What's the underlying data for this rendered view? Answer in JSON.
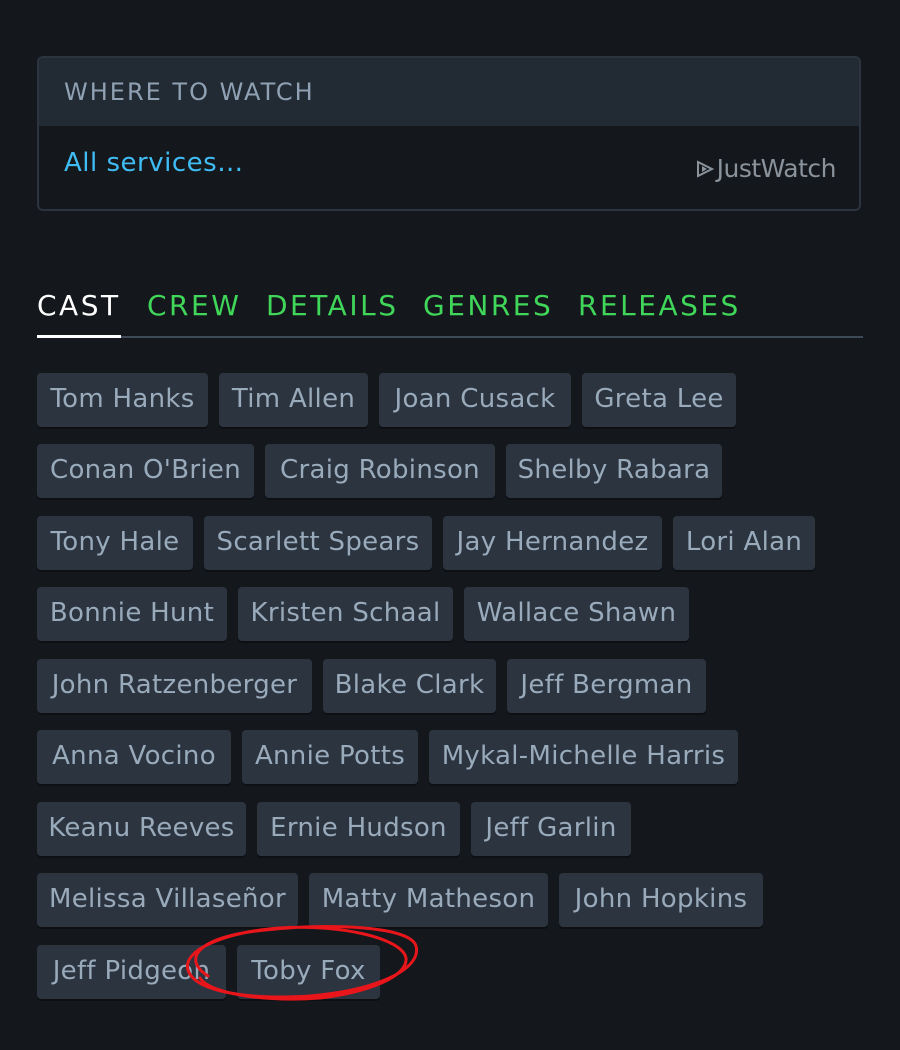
{
  "where_to_watch": {
    "heading": "WHERE TO WATCH",
    "link_label": "All services…",
    "provider_logo_text": "JustWatch"
  },
  "tabs": [
    {
      "label": "CAST",
      "active": true
    },
    {
      "label": "CREW",
      "active": false
    },
    {
      "label": "DETAILS",
      "active": false
    },
    {
      "label": "GENRES",
      "active": false
    },
    {
      "label": "RELEASES",
      "active": false
    }
  ],
  "cast": [
    "Tom Hanks",
    "Tim Allen",
    "Joan Cusack",
    "Greta Lee",
    "Conan O'Brien",
    "Craig Robinson",
    "Shelby Rabara",
    "Tony Hale",
    "Scarlett Spears",
    "Jay Hernandez",
    "Lori Alan",
    "Bonnie Hunt",
    "Kristen Schaal",
    "Wallace Shawn",
    "John Ratzenberger",
    "Blake Clark",
    "Jeff Bergman",
    "Anna Vocino",
    "Annie Potts",
    "Mykal-Michelle Harris",
    "Keanu Reeves",
    "Ernie Hudson",
    "Jeff Garlin",
    "Melissa Villaseñor",
    "Matty Matheson",
    "John Hopkins",
    "Jeff Pidgeon",
    "Toby Fox"
  ],
  "colors": {
    "background": "#14181c",
    "chip_background": "#2c3440",
    "chip_text": "#99aabb",
    "tab_inactive": "#40d659",
    "tab_active": "#ffffff",
    "link": "#40bcf4",
    "annotation": "#e8161b"
  },
  "icons": {
    "provider_logo": "justwatch-play-icon"
  }
}
